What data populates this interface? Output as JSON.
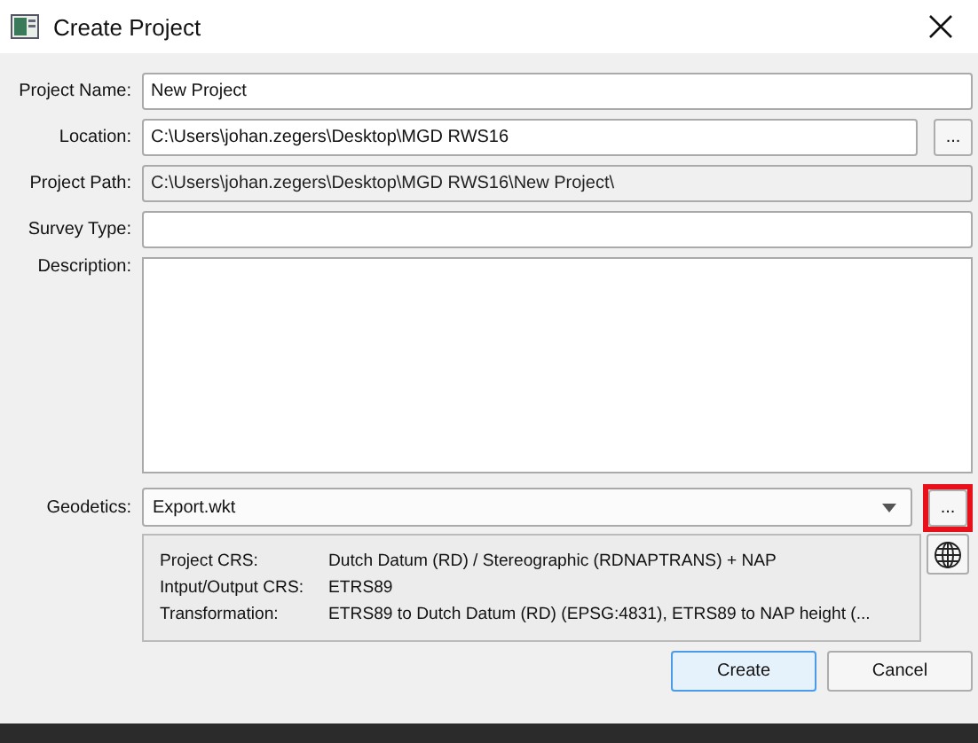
{
  "window": {
    "title": "Create Project"
  },
  "fields": [
    {
      "label": "Project Name:",
      "kind": "text",
      "value": "New Project"
    },
    {
      "label": "Location:",
      "kind": "browse",
      "value": "C:\\Users\\johan.zegers\\Desktop\\MGD RWS16",
      "button": "..."
    },
    {
      "label": "Project Path:",
      "kind": "readonly",
      "value": "C:\\Users\\johan.zegers\\Desktop\\MGD RWS16\\New Project\\"
    },
    {
      "label": "Survey Type:",
      "kind": "text"
    },
    {
      "label": "Description:",
      "kind": "textarea"
    }
  ],
  "geodetics": {
    "label": "Geodetics:",
    "value": "Export.wkt",
    "button": "...",
    "highlighted": true,
    "info": [
      {
        "label": "Project CRS:",
        "value": "Dutch Datum (RD) / Stereographic (RDNAPTRANS) + NAP"
      },
      {
        "label": "Intput/Output CRS:",
        "value": "ETRS89"
      },
      {
        "label": "Transformation:",
        "value": "ETRS89 to Dutch Datum (RD) (EPSG:4831), ETRS89 to NAP height (..."
      }
    ]
  },
  "buttons": [
    {
      "label": "Create",
      "default": true
    },
    {
      "label": "Cancel",
      "default": false
    }
  ]
}
